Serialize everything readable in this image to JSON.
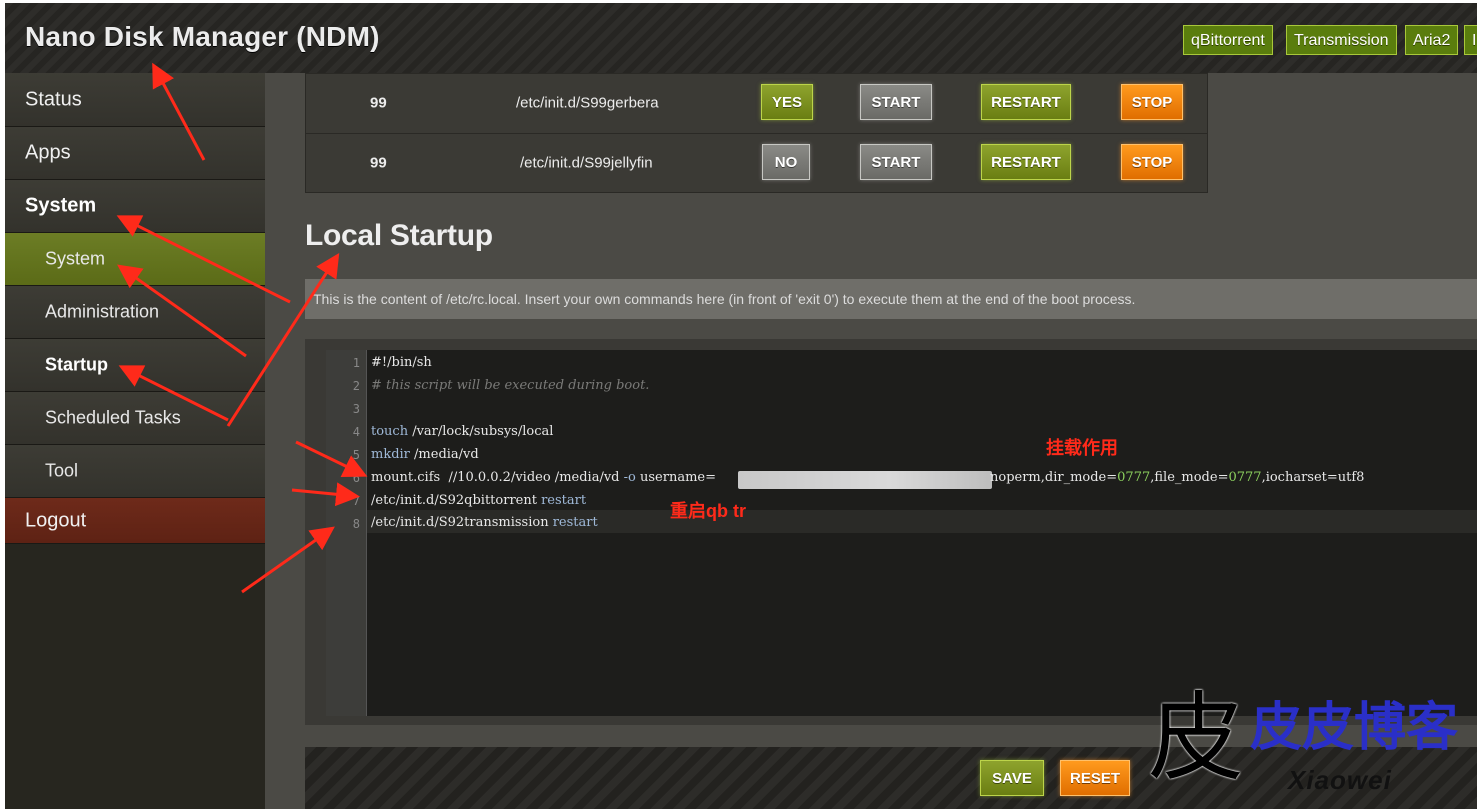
{
  "app": {
    "title": "Nano Disk Manager (NDM)"
  },
  "top_buttons": [
    "qBittorrent",
    "Transmission",
    "Aria2",
    "I"
  ],
  "sidebar": {
    "items": [
      {
        "label": "Status"
      },
      {
        "label": "Apps"
      },
      {
        "label": "System"
      },
      {
        "label": "System"
      },
      {
        "label": "Administration"
      },
      {
        "label": "Startup"
      },
      {
        "label": "Scheduled Tasks"
      },
      {
        "label": "Tool"
      },
      {
        "label": "Logout"
      }
    ]
  },
  "init_rows": [
    {
      "priority": "99",
      "script": "/etc/init.d/S99gerbera",
      "enabled": "YES",
      "start": "START",
      "restart": "RESTART",
      "stop": "STOP"
    },
    {
      "priority": "99",
      "script": "/etc/init.d/S99jellyfin",
      "enabled": "NO",
      "start": "START",
      "restart": "RESTART",
      "stop": "STOP"
    }
  ],
  "local_startup": {
    "title": "Local Startup",
    "description": "This is the content of /etc/rc.local. Insert your own commands here (in front of 'exit 0') to execute them at the end of the boot process."
  },
  "editor": {
    "line_numbers": [
      "1",
      "2",
      "3",
      "4",
      "5",
      "6",
      "7",
      "8"
    ],
    "lines": {
      "l1": "#!/bin/sh",
      "l2": "# this script will be executed during boot.",
      "l4_kw": "touch",
      "l4_rest": " /var/lock/subsys/local",
      "l5_kw": "mkdir",
      "l5_rest": " /media/vd",
      "l6_a": "mount.cifs  //10.0.0.2/video /media/vd ",
      "l6_opt": "-o",
      "l6_b": " username=",
      "l6_c": "noperm,dir_mode=",
      "l6_n1": "0777",
      "l6_d": ",file_mode=",
      "l6_n2": "0777",
      "l6_e": ",iocharset=utf8",
      "l7_a": "/etc/init.d/S92qbittorrent ",
      "l7_kw": "restart",
      "l8_a": "/etc/init.d/S92transmission ",
      "l8_kw": "restart"
    }
  },
  "footer": {
    "save": "SAVE",
    "reset": "RESET"
  },
  "annotations": {
    "mount_note": "挂载作用",
    "restart_note": "重启qb tr"
  },
  "watermark": {
    "big": "皮",
    "cn": "皮皮博客",
    "en": "Xiaowei"
  }
}
